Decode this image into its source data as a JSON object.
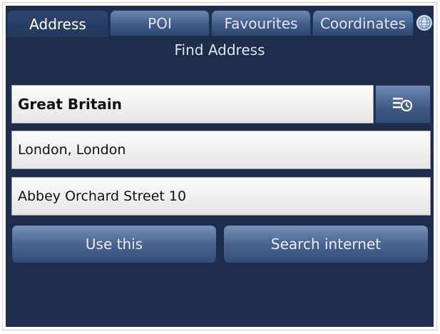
{
  "tabs": [
    {
      "label": "Address",
      "active": true
    },
    {
      "label": "POI",
      "active": false
    },
    {
      "label": "Favourites",
      "active": false
    },
    {
      "label": "Coordinates",
      "active": false
    }
  ],
  "tab_icon": "globe-icon",
  "heading": "Find Address",
  "fields": {
    "country": "Great Britain",
    "city": "London, London",
    "street": "Abbey Orchard Street 10"
  },
  "history_icon": "history-list-icon",
  "buttons": {
    "use": "Use this",
    "search": "Search internet"
  },
  "colors": {
    "background": "#1e2d4b",
    "tab": "#4a6591",
    "field": "#eeeeee",
    "text_light": "#dfe6f2"
  }
}
